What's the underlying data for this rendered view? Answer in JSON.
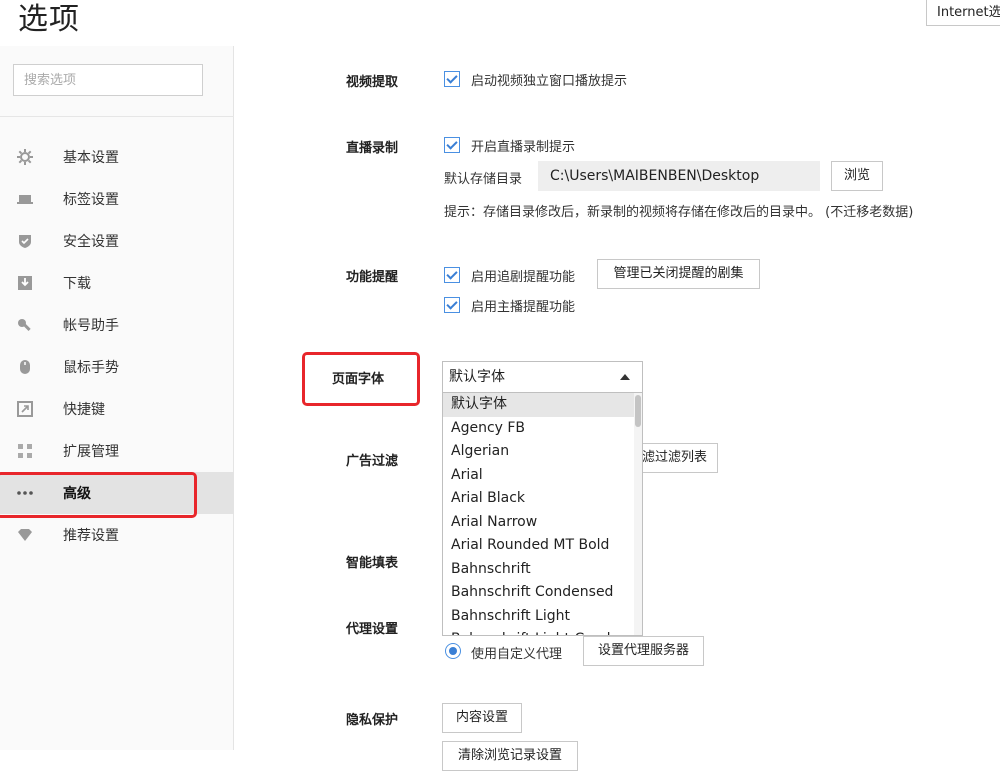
{
  "window": {
    "title": "选项",
    "ie_button": "Internet选"
  },
  "sidebar": {
    "search_placeholder": "搜索选项",
    "items": [
      {
        "label": "基本设置",
        "icon": "gear-icon"
      },
      {
        "label": "标签设置",
        "icon": "laptop-icon"
      },
      {
        "label": "安全设置",
        "icon": "shield-icon"
      },
      {
        "label": "下载",
        "icon": "download-icon"
      },
      {
        "label": "帐号助手",
        "icon": "key-icon"
      },
      {
        "label": "鼠标手势",
        "icon": "mouse-icon"
      },
      {
        "label": "快捷键",
        "icon": "shortcut-icon"
      },
      {
        "label": "扩展管理",
        "icon": "grid-icon"
      },
      {
        "label": "高级",
        "icon": "more-icon"
      },
      {
        "label": "推荐设置",
        "icon": "diamond-icon"
      }
    ],
    "active_index": 8
  },
  "main": {
    "video": {
      "label": "视频提取",
      "option": "启动视频独立窗口播放提示",
      "checked": true
    },
    "live": {
      "label": "直播录制",
      "option": "开启直播录制提示",
      "checked": true,
      "dir_label": "默认存储目录",
      "dir_value": "C:\\Users\\MAIBENBEN\\Desktop",
      "browse": "浏览",
      "hint": "提示：存储目录修改后，新录制的视频将存储在修改后的目录中。 (不迁移老数据)"
    },
    "reminder": {
      "label": "功能提醒",
      "option1": "启用追剧提醒功能",
      "manage_button": "管理已关闭提醒的剧集",
      "option2": "启用主播提醒功能"
    },
    "font": {
      "label": "页面字体",
      "selected": "默认字体",
      "options": [
        "默认字体",
        "Agency FB",
        "Algerian",
        "Arial",
        "Arial Black",
        "Arial Narrow",
        "Arial Rounded MT Bold",
        "Bahnschrift",
        "Bahnschrift Condensed",
        "Bahnschrift Light",
        "Bahnschrift Light Condensed"
      ]
    },
    "ad": {
      "label": "广告过滤",
      "button_partial": "滤过滤列表"
    },
    "autofill": {
      "label": "智能填表"
    },
    "proxy": {
      "label": "代理设置",
      "option": "使用自定义代理",
      "button": "设置代理服务器"
    },
    "privacy": {
      "label": "隐私保护",
      "button": "内容设置",
      "button2": "清除浏览记录设置"
    }
  }
}
